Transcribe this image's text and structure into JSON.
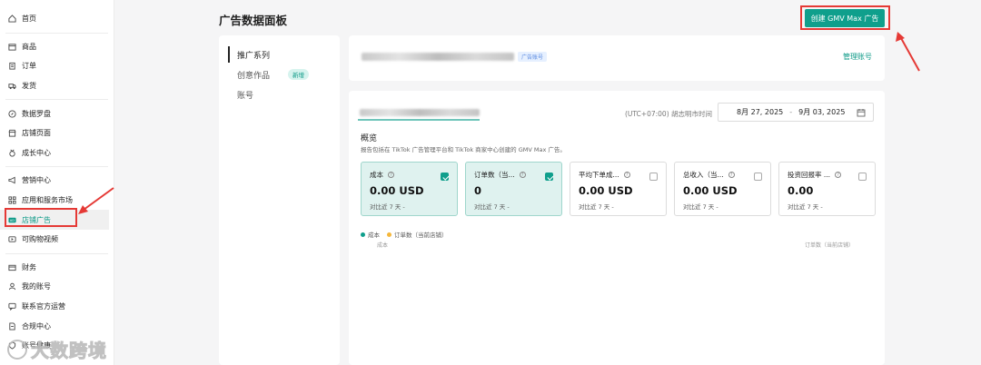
{
  "sidebar": {
    "groups": [
      [
        {
          "label": "首页",
          "icon": "home-icon"
        }
      ],
      [
        {
          "label": "商品",
          "icon": "box-icon"
        },
        {
          "label": "订单",
          "icon": "clipboard-icon"
        },
        {
          "label": "发货",
          "icon": "truck-icon"
        }
      ],
      [
        {
          "label": "数据罗盘",
          "icon": "compass-icon"
        },
        {
          "label": "店铺页面",
          "icon": "store-icon"
        },
        {
          "label": "成长中心",
          "icon": "medal-icon"
        }
      ],
      [
        {
          "label": "营销中心",
          "icon": "megaphone-icon"
        },
        {
          "label": "应用和服务市场",
          "icon": "grid-icon"
        },
        {
          "label": "店铺广告",
          "icon": "ads-icon",
          "active": true
        },
        {
          "label": "可购物视频",
          "icon": "video-icon"
        }
      ],
      [
        {
          "label": "财务",
          "icon": "wallet-icon"
        },
        {
          "label": "我的账号",
          "icon": "user-icon"
        },
        {
          "label": "联系官方运营",
          "icon": "chat-icon"
        },
        {
          "label": "合规中心",
          "icon": "document-icon"
        },
        {
          "label": "账号健康",
          "icon": "shield-icon"
        }
      ]
    ]
  },
  "header": {
    "title": "广告数据面板",
    "create_button": "创建 GMV Max 广告"
  },
  "tabs": [
    {
      "label": "推广系列",
      "active": true
    },
    {
      "label": "创意作品",
      "badge": "新增"
    },
    {
      "label": "账号"
    }
  ],
  "account": {
    "tag": "广告账号",
    "manage_link": "管理账号"
  },
  "main": {
    "timezone": "(UTC+07:00) 胡志明市时间",
    "date_start": "8月 27, 2025",
    "date_end": "9月 03, 2025",
    "date_sep": "-",
    "overview_title": "概览",
    "overview_desc": "报告包括在 TikTok 广告管理平台和 TikTok 商家中心创建的 GMV Max 广告。",
    "metrics": [
      {
        "label": "成本",
        "value": "0.00 USD",
        "compare": "对比近 7 天 -",
        "selected": true
      },
      {
        "label": "订单数（当...",
        "value": "0",
        "compare": "对比近 7 天 -",
        "selected": true
      },
      {
        "label": "平均下单成...",
        "value": "0.00 USD",
        "compare": "对比近 7 天 -",
        "selected": false
      },
      {
        "label": "总收入（当...",
        "value": "0.00 USD",
        "compare": "对比近 7 天 -",
        "selected": false
      },
      {
        "label": "投资回报率 ...",
        "value": "0.00",
        "compare": "对比近 7 天 -",
        "selected": false
      }
    ],
    "legend": [
      {
        "label": "成本",
        "color": "#0f9f8c"
      },
      {
        "label": "订单数（当前店铺）",
        "color": "#f5b73b"
      }
    ],
    "axis_left": "成本",
    "axis_right": "订单数（当前店铺）"
  },
  "watermark": {
    "text": "大数跨境"
  },
  "colors": {
    "accent": "#0f9f8c",
    "annotation": "#e53935"
  }
}
